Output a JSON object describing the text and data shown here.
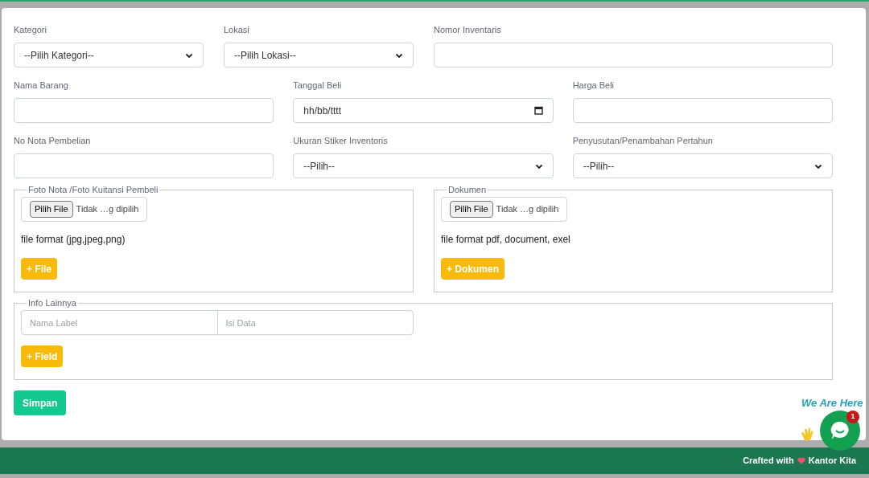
{
  "form_rows": [
    {
      "fields": [
        {
          "label": "Kategori",
          "kind": "select",
          "value": "--Pilih Kategori--"
        },
        {
          "label": "Lokasi",
          "kind": "select",
          "value": "--Pilih Lokasi--"
        },
        {
          "label": "Nomor Inventaris",
          "kind": "text"
        }
      ]
    },
    {
      "fields": [
        {
          "label": "Nama Barang",
          "kind": "text"
        },
        {
          "label": "Tanggal Beli",
          "kind": "date",
          "value": "hh/bb/tttt"
        },
        {
          "label": "Harga Beli",
          "kind": "text"
        }
      ]
    },
    {
      "fields": [
        {
          "label": "No Nota Pembelian",
          "kind": "text"
        },
        {
          "label": "Ukuran Stiker Inventoris",
          "kind": "select",
          "value": "--Pilih--"
        },
        {
          "label": "Penyusutan/Penambahan Pertahun",
          "kind": "select",
          "value": "--Pilih--"
        }
      ]
    }
  ],
  "uploads": [
    {
      "legend": "Foto Nota /Foto Kuitansi Pembeli",
      "choose_button": "Pilih File",
      "status": "Tidak …g dipilih",
      "note": "file format (jpg,jpeg,png)",
      "add_button": "+ File"
    },
    {
      "legend": "Dokumen",
      "choose_button": "Pilih File",
      "status": "Tidak …g dipilih",
      "note": "file format pdf, document, exel",
      "add_button": "+ Dokumen"
    }
  ],
  "info": {
    "legend": "Info Lainnya",
    "fields": [
      {
        "placeholder": "Nama Label"
      },
      {
        "placeholder": "Isi Data"
      }
    ],
    "add_button": "+ Field"
  },
  "submit_button": "Simpan",
  "chat_widget": {
    "caption": "We Are Here",
    "badge": "1"
  },
  "footer": {
    "text": "Crafted with",
    "brand": "Kantor Kita"
  }
}
